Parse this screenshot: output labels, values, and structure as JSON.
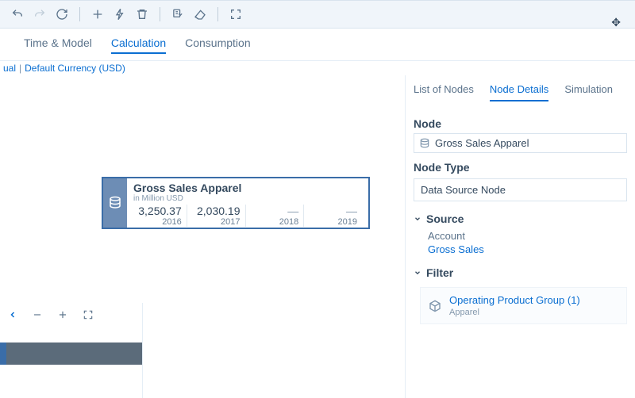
{
  "toolbar": {
    "icons": [
      "undo",
      "redo",
      "refresh",
      "add",
      "spark",
      "delete",
      "copy-menu",
      "eraser",
      "fit"
    ]
  },
  "tabs": {
    "items": [
      "Time & Model",
      "Calculation",
      "Consumption"
    ],
    "active": 1
  },
  "breadcrumb": {
    "item0": "ual",
    "item1": "Default Currency (USD)"
  },
  "node_card": {
    "title": "Gross Sales Apparel",
    "subtitle": "in Million USD",
    "cells": [
      {
        "value": "3,250.37",
        "year": "2016"
      },
      {
        "value": "2,030.19",
        "year": "2017"
      },
      {
        "value": "—",
        "year": "2018"
      },
      {
        "value": "—",
        "year": "2019"
      }
    ]
  },
  "side": {
    "tabs": [
      "List of Nodes",
      "Node Details",
      "Simulation"
    ],
    "active": 1,
    "node_label": "Node",
    "node_name": "Gross Sales Apparel",
    "node_type_label": "Node Type",
    "node_type": "Data Source Node",
    "source_label": "Source",
    "account_label": "Account",
    "account_value": "Gross Sales",
    "filter_label": "Filter",
    "filter_item_title": "Operating Product Group (1)",
    "filter_item_sub": "Apparel"
  },
  "mini": {
    "tools": [
      "back",
      "zoom-out",
      "zoom-in",
      "fullscreen"
    ]
  }
}
